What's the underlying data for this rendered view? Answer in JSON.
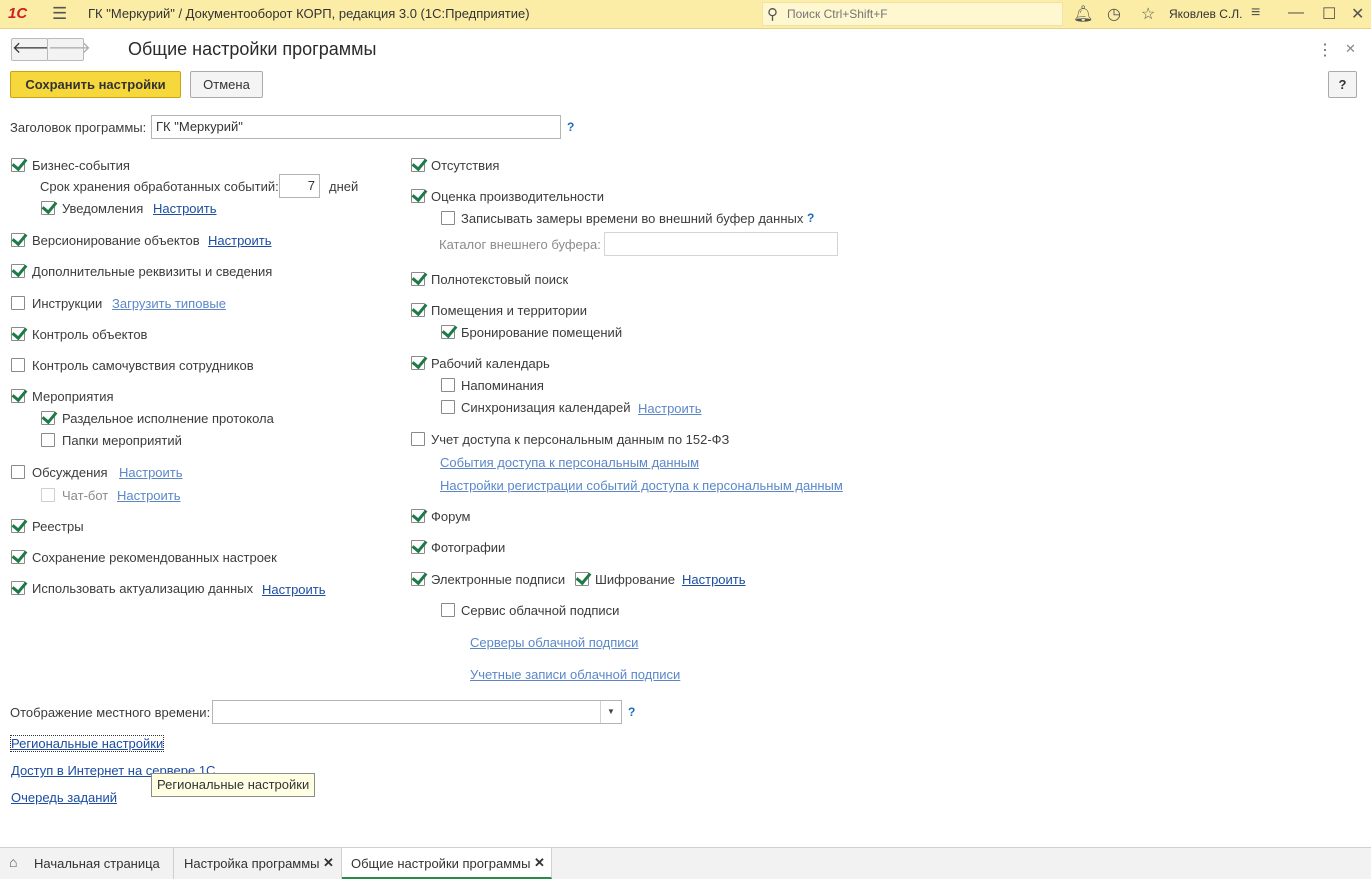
{
  "topbar": {
    "logo": "1С",
    "app_title": "ГК \"Меркурий\" / Документооборот КОРП, редакция 3.0  (1С:Предприятие)",
    "search_placeholder": "Поиск Ctrl+Shift+F",
    "user": "Яковлев С.Л.",
    "icons": [
      "menu-icon",
      "search-icon",
      "bell-icon",
      "history-icon",
      "star-icon",
      "user-icon",
      "settings-icon",
      "minimize-icon",
      "maximize-icon",
      "close-icon"
    ]
  },
  "header": {
    "title": "Общие настройки программы",
    "save_label": "Сохранить настройки",
    "cancel_label": "Отмена",
    "help_label": "?"
  },
  "app_title": {
    "label": "Заголовок программы:",
    "value": "ГК \"Меркурий\"",
    "help": "?"
  },
  "left": {
    "business_events": {
      "label": "Бизнес-события",
      "checked": true
    },
    "retention_label": "Срок хранения обработанных событий:",
    "retention_value": "7",
    "retention_unit": "дней",
    "notifications": {
      "label": "Уведомления",
      "checked": true,
      "link": "Настроить"
    },
    "versioning": {
      "label": "Версионирование объектов",
      "checked": true,
      "link": "Настроить"
    },
    "additional_props": {
      "label": "Дополнительные реквизиты и сведения",
      "checked": true
    },
    "instructions": {
      "label": "Инструкции",
      "checked": false,
      "link": "Загрузить типовые"
    },
    "object_control": {
      "label": "Контроль объектов",
      "checked": true
    },
    "wellbeing": {
      "label": "Контроль самочувствия сотрудников",
      "checked": false
    },
    "events": {
      "label": "Мероприятия",
      "checked": true
    },
    "protocol": {
      "label": "Раздельное исполнение протокола",
      "checked": true
    },
    "event_folders": {
      "label": "Папки мероприятий",
      "checked": false
    },
    "discussions": {
      "label": "Обсуждения",
      "checked": false,
      "link": "Настроить"
    },
    "chatbot": {
      "label": "Чат-бот",
      "checked": false,
      "link": "Настроить"
    },
    "registries": {
      "label": "Реестры",
      "checked": true
    },
    "saved_settings": {
      "label": "Сохранение рекомендованных настроек",
      "checked": true
    },
    "data_update": {
      "label": "Использовать актуализацию данных",
      "checked": true,
      "link": "Настроить"
    }
  },
  "right": {
    "absences": {
      "label": "Отсутствия",
      "checked": true
    },
    "performance": {
      "label": "Оценка производительности",
      "checked": true
    },
    "time_buffer": {
      "label": "Записывать замеры времени во внешний буфер данных",
      "checked": false,
      "help": "?"
    },
    "buffer_dir_label": "Каталог внешнего буфера:",
    "buffer_dir_value": "",
    "fulltext": {
      "label": "Полнотекстовый поиск",
      "checked": true
    },
    "premises": {
      "label": "Помещения и территории",
      "checked": true
    },
    "booking": {
      "label": "Бронирование помещений",
      "checked": true
    },
    "calendar": {
      "label": "Рабочий календарь",
      "checked": true
    },
    "reminders": {
      "label": "Напоминания",
      "checked": false
    },
    "cal_sync": {
      "label": "Синхронизация календарей",
      "checked": false,
      "link": "Настроить"
    },
    "pd_access": {
      "label": "Учет доступа к персональным данным по 152-ФЗ",
      "checked": false
    },
    "pd_events_link": "События доступа к персональным данным",
    "pd_settings_link": "Настройки регистрации событий доступа к персональным данным",
    "forum": {
      "label": "Форум",
      "checked": true
    },
    "photos": {
      "label": "Фотографии",
      "checked": true
    },
    "esign": {
      "label": "Электронные подписи",
      "checked": true
    },
    "encryption": {
      "label": "Шифрование",
      "checked": true,
      "link": "Настроить"
    },
    "cloud_sign": {
      "label": "Сервис облачной подписи",
      "checked": false
    },
    "cloud_servers_link": "Серверы облачной подписи",
    "cloud_accounts_link": "Учетные записи облачной подписи"
  },
  "bottom": {
    "local_time_label": "Отображение местного времени:",
    "local_time_value": "",
    "help": "?",
    "regional_link": "Региональные настройки",
    "internet_link": "Доступ в Интернет на сервере 1С",
    "jobs_link": "Очередь заданий",
    "tooltip": "Региональные настройки"
  },
  "tabs": [
    {
      "label": "Начальная страница",
      "active": false
    },
    {
      "label": "Настройка программы",
      "active": false
    },
    {
      "label": "Общие настройки программы",
      "active": true
    }
  ]
}
